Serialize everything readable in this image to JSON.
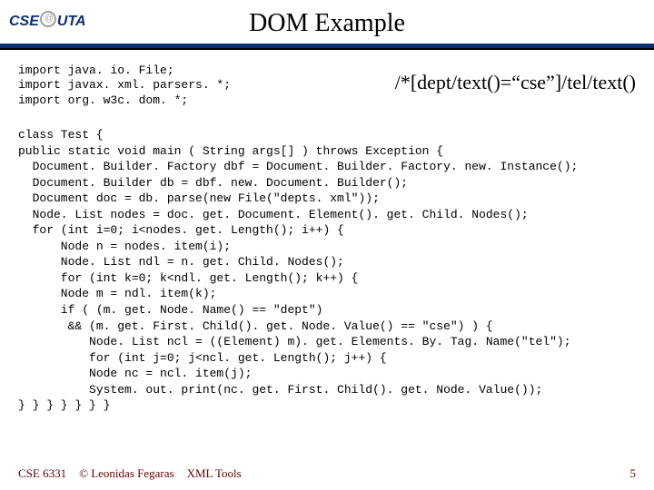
{
  "logo": {
    "left": "CSE",
    "right": "UTA"
  },
  "title": "DOM Example",
  "imports": "import java. io. File;\nimport javax. xml. parsers. *;\nimport org. w3c. dom. *;",
  "xpath": "/*[dept/text()=“cse”]/tel/text()",
  "code": "class Test {\npublic static void main ( String args[] ) throws Exception {\n  Document. Builder. Factory dbf = Document. Builder. Factory. new. Instance();\n  Document. Builder db = dbf. new. Document. Builder();\n  Document doc = db. parse(new File(\"depts. xml\"));\n  Node. List nodes = doc. get. Document. Element(). get. Child. Nodes();\n  for (int i=0; i<nodes. get. Length(); i++) {\n      Node n = nodes. item(i);\n      Node. List ndl = n. get. Child. Nodes();\n      for (int k=0; k<ndl. get. Length(); k++) {\n      Node m = ndl. item(k);\n      if ( (m. get. Node. Name() == \"dept\")\n       && (m. get. First. Child(). get. Node. Value() == \"cse\") ) {\n          Node. List ncl = ((Element) m). get. Elements. By. Tag. Name(\"tel\");\n          for (int j=0; j<ncl. get. Length(); j++) {\n          Node nc = ncl. item(j);\n          System. out. print(nc. get. First. Child(). get. Node. Value());\n} } } } } } }",
  "footer": {
    "course": "CSE 6331",
    "author": "© Leonidas Fegaras",
    "section": "XML Tools",
    "page": "5"
  }
}
